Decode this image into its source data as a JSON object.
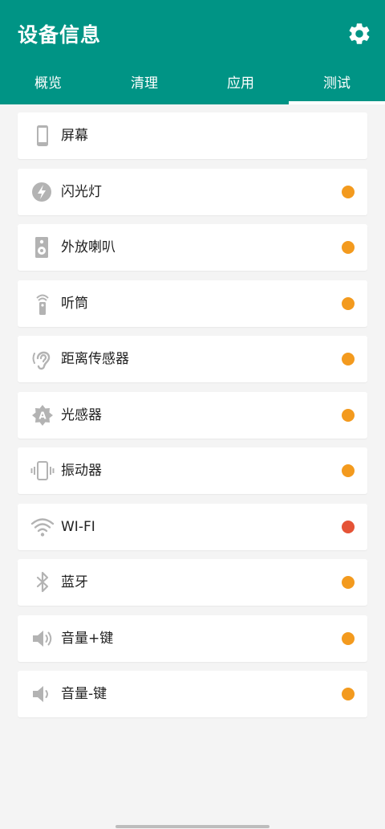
{
  "app": {
    "title": "设备信息"
  },
  "colors": {
    "primary": "#009485",
    "dot_orange": "#F39A1E",
    "dot_red": "#E55336",
    "icon_gray": "#b3b3b3"
  },
  "tabs": [
    {
      "label": "概览",
      "active": false
    },
    {
      "label": "清理",
      "active": false
    },
    {
      "label": "应用",
      "active": false
    },
    {
      "label": "测试",
      "active": true
    }
  ],
  "items": [
    {
      "label": "屏幕",
      "icon": "phone-icon",
      "status": "none"
    },
    {
      "label": "闪光灯",
      "icon": "flash-icon",
      "status": "orange"
    },
    {
      "label": "外放喇叭",
      "icon": "speaker-icon",
      "status": "orange"
    },
    {
      "label": "听筒",
      "icon": "earpiece-icon",
      "status": "orange"
    },
    {
      "label": "距离传感器",
      "icon": "ear-icon",
      "status": "orange"
    },
    {
      "label": "光感器",
      "icon": "auto-brightness-icon",
      "status": "orange"
    },
    {
      "label": "振动器",
      "icon": "vibration-icon",
      "status": "orange"
    },
    {
      "label": "WI-FI",
      "icon": "wifi-icon",
      "status": "red"
    },
    {
      "label": "蓝牙",
      "icon": "bluetooth-icon",
      "status": "orange"
    },
    {
      "label": "音量+键",
      "icon": "volume-up-icon",
      "status": "orange"
    },
    {
      "label": "音量-键",
      "icon": "volume-down-icon",
      "status": "orange"
    }
  ]
}
